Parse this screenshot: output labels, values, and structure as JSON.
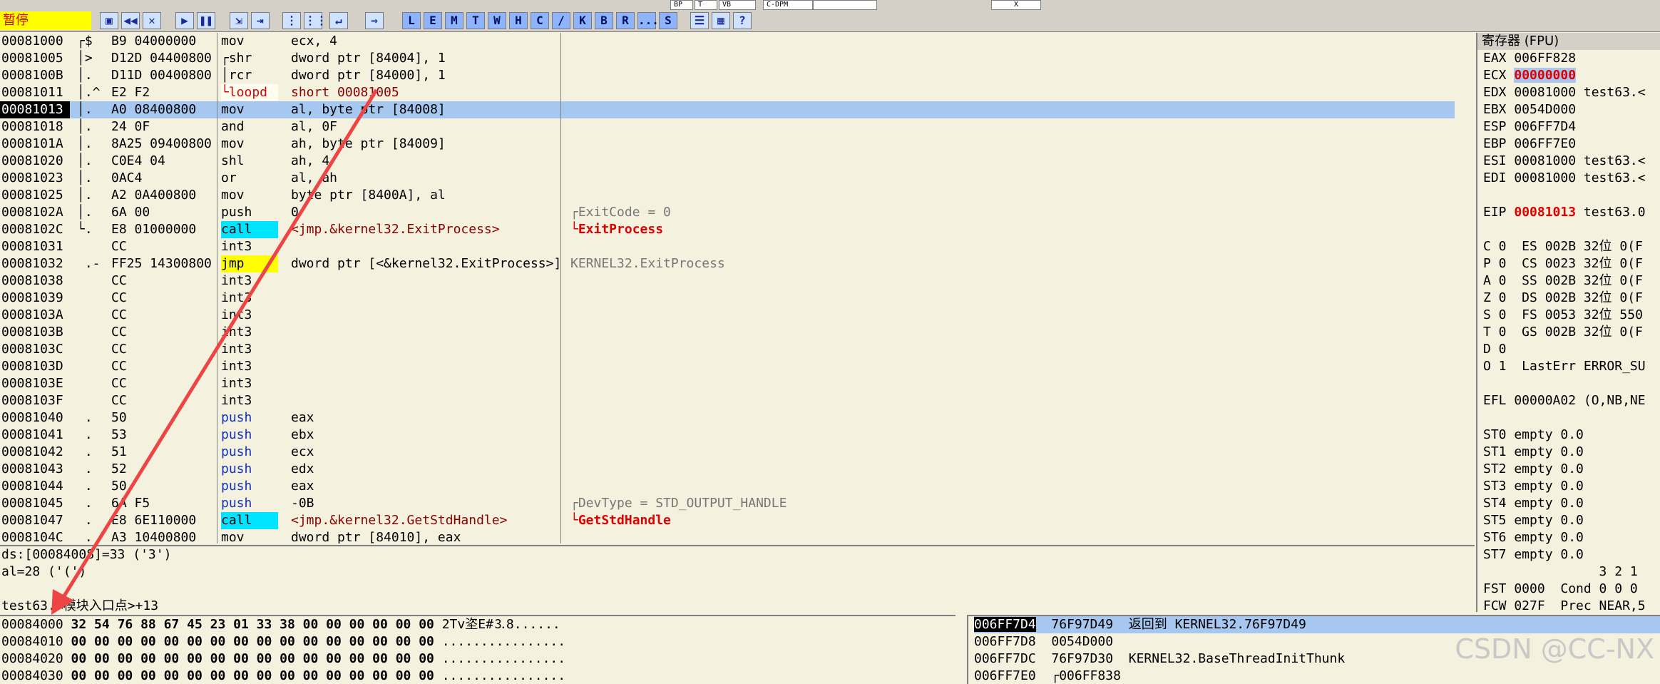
{
  "status_label": "暂停",
  "top_fields": [
    "BP",
    "T",
    "VB",
    "C-DPM",
    "",
    "X"
  ],
  "toolbar_icons": [
    "open-icon",
    "rewind-icon",
    "close-icon",
    "run-icon",
    "pause-icon",
    "step-into-icon",
    "step-over-icon",
    "trace-into-icon",
    "trace-over-icon",
    "execute-till-return-icon",
    "goto-icon"
  ],
  "toolbar_letters": [
    "L",
    "E",
    "M",
    "T",
    "W",
    "H",
    "C",
    "/",
    "K",
    "B",
    "R",
    "...",
    "S"
  ],
  "toolbar_extra_icons": [
    "list-icon",
    "grid-icon",
    "help-icon"
  ],
  "disasm": [
    {
      "addr": "00081000",
      "marker": "┌$",
      "hex": "B9 04000000",
      "mn": "mov",
      "ops": "ecx, 4",
      "num": "4",
      "comment": ""
    },
    {
      "addr": "00081005",
      "marker": "│>",
      "hex": "D12D 04400800",
      "mn": "┌shr",
      "ops": "dword ptr [84004], 1",
      "comment": ""
    },
    {
      "addr": "0008100B",
      "marker": "│.",
      "hex": "D11D 00400800",
      "mn": "│rcr",
      "ops": "dword ptr [84000], 1",
      "comment": ""
    },
    {
      "addr": "00081011",
      "marker": "│.^",
      "hex": "E2 F2",
      "mn": "└loopd",
      "ops": "short 00081005",
      "comment": "",
      "style": "loop"
    },
    {
      "addr": "00081013",
      "marker": "│.",
      "hex": "A0 08400800",
      "mn": "mov",
      "ops": "al, byte ptr [84008]",
      "comment": "",
      "sel": true
    },
    {
      "addr": "00081018",
      "marker": "│.",
      "hex": "24 0F",
      "mn": "and",
      "ops": "al, 0F",
      "comment": ""
    },
    {
      "addr": "0008101A",
      "marker": "│.",
      "hex": "8A25 09400800",
      "mn": "mov",
      "ops": "ah, byte ptr [84009]",
      "comment": ""
    },
    {
      "addr": "00081020",
      "marker": "│.",
      "hex": "C0E4 04",
      "mn": "shl",
      "ops": "ah, 4",
      "comment": ""
    },
    {
      "addr": "00081023",
      "marker": "│.",
      "hex": "0AC4",
      "mn": "or",
      "ops": "al, ah",
      "comment": ""
    },
    {
      "addr": "00081025",
      "marker": "│.",
      "hex": "A2 0A400800",
      "mn": "mov",
      "ops": "byte ptr [8400A], al",
      "comment": ""
    },
    {
      "addr": "0008102A",
      "marker": "│.",
      "hex": "6A 00",
      "mn": "push",
      "ops": "0",
      "comment": "┌ExitCode = 0"
    },
    {
      "addr": "0008102C",
      "marker": "└.",
      "hex": "E8 01000000",
      "mn": "call",
      "ops": "<jmp.&kernel32.ExitProcess>",
      "comment": "└ExitProcess",
      "style": "call",
      "cred": true
    },
    {
      "addr": "00081031",
      "marker": "",
      "hex": "CC",
      "mn": "int3",
      "ops": "",
      "comment": ""
    },
    {
      "addr": "00081032",
      "marker": " .-",
      "hex": "FF25 14300800",
      "mn": "jmp",
      "ops": "dword ptr [<&kernel32.ExitProcess>]",
      "comment": "KERNEL32.ExitProcess",
      "style": "jmp"
    },
    {
      "addr": "00081038",
      "marker": "",
      "hex": "CC",
      "mn": "int3",
      "ops": "",
      "comment": ""
    },
    {
      "addr": "00081039",
      "marker": "",
      "hex": "CC",
      "mn": "int3",
      "ops": "",
      "comment": ""
    },
    {
      "addr": "0008103A",
      "marker": "",
      "hex": "CC",
      "mn": "int3",
      "ops": "",
      "comment": ""
    },
    {
      "addr": "0008103B",
      "marker": "",
      "hex": "CC",
      "mn": "int3",
      "ops": "",
      "comment": ""
    },
    {
      "addr": "0008103C",
      "marker": "",
      "hex": "CC",
      "mn": "int3",
      "ops": "",
      "comment": ""
    },
    {
      "addr": "0008103D",
      "marker": "",
      "hex": "CC",
      "mn": "int3",
      "ops": "",
      "comment": ""
    },
    {
      "addr": "0008103E",
      "marker": "",
      "hex": "CC",
      "mn": "int3",
      "ops": "",
      "comment": ""
    },
    {
      "addr": "0008103F",
      "marker": "",
      "hex": "CC",
      "mn": "int3",
      "ops": "",
      "comment": ""
    },
    {
      "addr": "00081040",
      "marker": " .",
      "hex": "50",
      "mn": "push",
      "ops": "eax",
      "comment": "",
      "style": "push"
    },
    {
      "addr": "00081041",
      "marker": " .",
      "hex": "53",
      "mn": "push",
      "ops": "ebx",
      "comment": "",
      "style": "push"
    },
    {
      "addr": "00081042",
      "marker": " .",
      "hex": "51",
      "mn": "push",
      "ops": "ecx",
      "comment": "",
      "style": "push"
    },
    {
      "addr": "00081043",
      "marker": " .",
      "hex": "52",
      "mn": "push",
      "ops": "edx",
      "comment": "",
      "style": "push"
    },
    {
      "addr": "00081044",
      "marker": " .",
      "hex": "50",
      "mn": "push",
      "ops": "eax",
      "comment": "",
      "style": "push"
    },
    {
      "addr": "00081045",
      "marker": " .",
      "hex": "6A F5",
      "mn": "push",
      "ops": "-0B",
      "comment": "┌DevType = STD_OUTPUT_HANDLE",
      "style": "push"
    },
    {
      "addr": "00081047",
      "marker": " .",
      "hex": "E8 6E110000",
      "mn": "call",
      "ops": "<jmp.&kernel32.GetStdHandle>",
      "comment": "└GetStdHandle",
      "style": "call",
      "cred": true
    },
    {
      "addr": "0008104C",
      "marker": " .",
      "hex": "A3 10400800",
      "mn": "mov",
      "ops": "dword ptr [84010], eax",
      "comment": ""
    }
  ],
  "registers": {
    "title": "寄存器 (FPU)",
    "lines": [
      {
        "t": "EAX 006FF828"
      },
      {
        "t": "ECX ",
        "v": "00000000",
        "hl": true
      },
      {
        "t": "EDX 00081000 test63.<"
      },
      {
        "t": "EBX 0054D000"
      },
      {
        "t": "ESP 006FF7D4"
      },
      {
        "t": "EBP 006FF7E0"
      },
      {
        "t": "ESI 00081000 test63.<"
      },
      {
        "t": "EDI 00081000 test63.<"
      },
      {
        "t": ""
      },
      {
        "t": "EIP ",
        "v": "00081013",
        "red": true,
        "after": " test63.0"
      },
      {
        "t": ""
      },
      {
        "t": "C 0  ES 002B 32位 0(F"
      },
      {
        "t": "P 0  CS 0023 32位 0(F"
      },
      {
        "t": "A 0  SS 002B 32位 0(F"
      },
      {
        "t": "Z 0  DS 002B 32位 0(F"
      },
      {
        "t": "S 0  FS 0053 32位 550"
      },
      {
        "t": "T 0  GS 002B 32位 0(F"
      },
      {
        "t": "D 0"
      },
      {
        "t": "O 1  LastErr ERROR_SU"
      },
      {
        "t": ""
      },
      {
        "t": "EFL 00000A02 (O,NB,NE"
      },
      {
        "t": ""
      },
      {
        "t": "ST0 empty 0.0"
      },
      {
        "t": "ST1 empty 0.0"
      },
      {
        "t": "ST2 empty 0.0"
      },
      {
        "t": "ST3 empty 0.0"
      },
      {
        "t": "ST4 empty 0.0"
      },
      {
        "t": "ST5 empty 0.0"
      },
      {
        "t": "ST6 empty 0.0"
      },
      {
        "t": "ST7 empty 0.0"
      },
      {
        "t": "               3 2 1"
      },
      {
        "t": "FST 0000  Cond 0 0 0"
      },
      {
        "t": "FCW 027F  Prec NEAR,5"
      }
    ]
  },
  "info": [
    "ds:[00084008]=33 ('3')",
    "al=28 ('(')",
    "",
    "test63.<模块入口点>+13"
  ],
  "dump": [
    {
      "addr": "00084000",
      "hex": "32 54 76 88 67 45 23 01 33 38 00 00 00 00 00 00",
      "ascii": "2Tv垐E#⒊8......"
    },
    {
      "addr": "00084010",
      "hex": "00 00 00 00 00 00 00 00 00 00 00 00 00 00 00 00",
      "ascii": "................"
    },
    {
      "addr": "00084020",
      "hex": "00 00 00 00 00 00 00 00 00 00 00 00 00 00 00 00",
      "ascii": "................"
    },
    {
      "addr": "00084030",
      "hex": "00 00 00 00 00 00 00 00 00 00 00 00 00 00 00 00",
      "ascii": "................"
    }
  ],
  "stack": [
    {
      "addr": "006FF7D4",
      "val": "76F97D49",
      "comment": "返回到 KERNEL32.76F97D49",
      "sel": true
    },
    {
      "addr": "006FF7D8",
      "val": "0054D000",
      "comment": ""
    },
    {
      "addr": "006FF7DC",
      "val": "76F97D30",
      "comment": "KERNEL32.BaseThreadInitThunk"
    },
    {
      "addr": "006FF7E0",
      "val": "┌006FF838",
      "comment": ""
    }
  ],
  "watermark": "CSDN @CC-NX",
  "colors": {
    "selection": "#a6c8f0",
    "call": "#00e5ff",
    "jmp": "#ffff00",
    "accent_red": "#e00000",
    "arrow": "#ee4444"
  }
}
